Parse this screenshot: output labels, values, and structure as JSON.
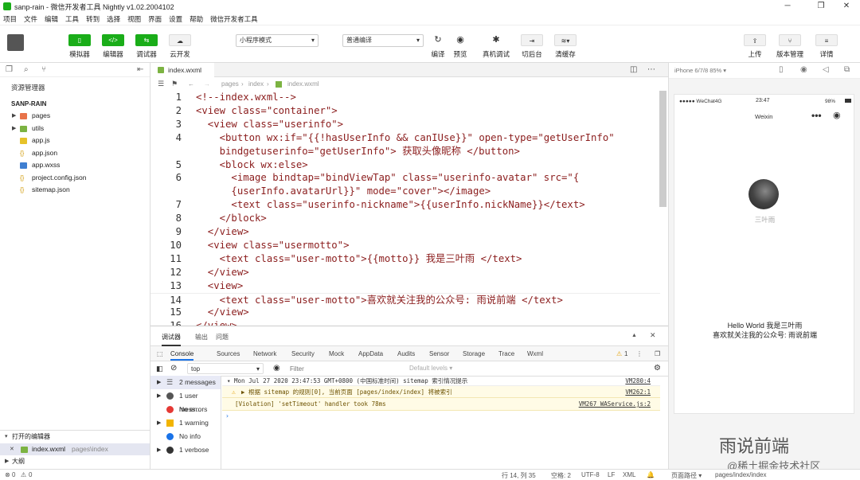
{
  "window": {
    "title": "sanp-rain - 微信开发者工具 Nightly v1.02.2004102"
  },
  "menu": [
    "项目",
    "文件",
    "编辑",
    "工具",
    "转到",
    "选择",
    "视图",
    "界面",
    "设置",
    "帮助",
    "微信开发者工具"
  ],
  "toolbar": {
    "simulator": "模拟器",
    "editor": "编辑器",
    "debugger": "调试器",
    "cloud": "云开发",
    "mode_select": "小程序模式",
    "compile_select": "普通编译",
    "compile": "编译",
    "preview": "预览",
    "realdebug": "真机调试",
    "background": "切后台",
    "clearcache": "清缓存",
    "upload": "上传",
    "version": "版本管理",
    "details": "详情"
  },
  "explorer": {
    "header": "资源管理器",
    "project": "SANP-RAIN",
    "items": [
      "pages",
      "utils",
      "app.js",
      "app.json",
      "app.wxss",
      "project.config.json",
      "sitemap.json"
    ],
    "open_editors": "打开的编辑器",
    "open_file": "index.wxml",
    "open_file_path": "pages\\index",
    "outline": "大纲"
  },
  "editor": {
    "tab": "index.wxml",
    "breadcrumb": [
      "pages",
      "index",
      "index.wxml"
    ],
    "lines": [
      {
        "n": "1",
        "t": "<!--index.wxml-->"
      },
      {
        "n": "2",
        "t": "<view class=\"container\">"
      },
      {
        "n": "3",
        "t": "  <view class=\"userinfo\">"
      },
      {
        "n": "4",
        "t": "    <button wx:if=\"{{!hasUserInfo && canIUse}}\" open-type=\"getUserInfo\""
      },
      {
        "n": "",
        "t": "    bindgetuserinfo=\"getUserInfo\"> 获取头像昵称 </button>"
      },
      {
        "n": "5",
        "t": "    <block wx:else>"
      },
      {
        "n": "6",
        "t": "      <image bindtap=\"bindViewTap\" class=\"userinfo-avatar\" src=\"{"
      },
      {
        "n": "",
        "t": "      {userInfo.avatarUrl}}\" mode=\"cover\"></image>"
      },
      {
        "n": "7",
        "t": "      <text class=\"userinfo-nickname\">{{userInfo.nickName}}</text>"
      },
      {
        "n": "8",
        "t": "    </block>"
      },
      {
        "n": "9",
        "t": "  </view>"
      },
      {
        "n": "10",
        "t": "  <view class=\"usermotto\">"
      },
      {
        "n": "11",
        "t": "    <text class=\"user-motto\">{{motto}} 我是三叶雨 </text>"
      },
      {
        "n": "12",
        "t": "  </view>"
      },
      {
        "n": "13",
        "t": "  <view>"
      },
      {
        "n": "14",
        "t": "    <text class=\"user-motto\">喜欢就关注我的公众号: 雨说前端 </text>"
      },
      {
        "n": "15",
        "t": "  </view>"
      },
      {
        "n": "16",
        "t": "</view>"
      }
    ]
  },
  "debug": {
    "tabs": [
      "调试器",
      "输出",
      "问题"
    ],
    "subtabs": [
      "Console",
      "Sources",
      "Network",
      "Security",
      "Mock",
      "AppData",
      "Audits",
      "Sensor",
      "Storage",
      "Trace",
      "Wxml"
    ],
    "context": "top",
    "filter_placeholder": "Filter",
    "levels": "Default levels ▾",
    "warn_count": "1",
    "sidebar": [
      "2 messages",
      "1 user mess...",
      "No errors",
      "1 warning",
      "No info",
      "1 verbose"
    ],
    "log1": "▾ Mon Jul 27 2020 23:47:53 GMT+0800 (中国标准时间) sitemap 索引情况提示",
    "log1_src": "VM280:4",
    "log2": "▶ 根据 sitemap 的规则[0], 当前页面 [pages/index/index] 将被索引",
    "log2_src": "VM262:1",
    "log3": "[Violation] 'setTimeout' handler took 78ms",
    "log3_src": "VM267 WAService.js:2"
  },
  "simulator": {
    "device": "iPhone 6/7/8 85% ▾",
    "carrier": "●●●●● WeChat4G",
    "time": "23:47",
    "battery": "98%",
    "nav_title": "Weixin",
    "nickname": "三叶雨",
    "hello": "Hello World 我是三叶雨",
    "follow": "喜欢就关注我的公众号: 雨说前端"
  },
  "status": {
    "errors": "0",
    "warnings": "0",
    "position": "行 14, 列 35",
    "spaces": "空格: 2",
    "encoding": "UTF-8",
    "eol": "LF",
    "lang": "XML",
    "page_path_label": "页面路径 ▾",
    "page_path": "pages/index/index"
  },
  "watermark": {
    "a": "雨说前端",
    "b": "@稀土掘金技术社区"
  }
}
